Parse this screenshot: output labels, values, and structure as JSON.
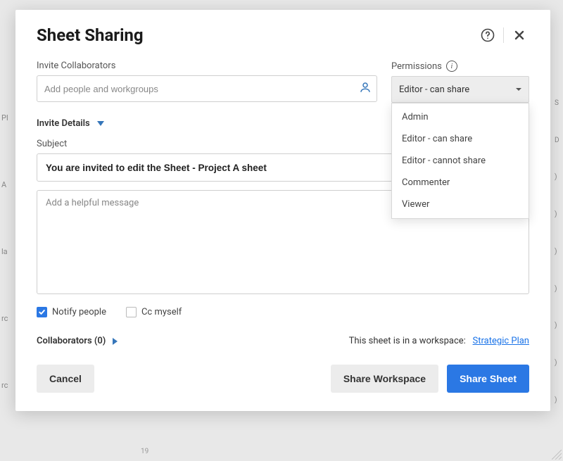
{
  "modal": {
    "title": "Sheet Sharing",
    "invite_label": "Invite Collaborators",
    "invite_placeholder": "Add people and workgroups",
    "permissions_label": "Permissions",
    "permissions_selected": "Editor - can share",
    "permissions_options": [
      "Admin",
      "Editor - can share",
      "Editor - cannot share",
      "Commenter",
      "Viewer"
    ],
    "invite_details_label": "Invite Details",
    "subject_label": "Subject",
    "subject_value": "You are invited to edit the Sheet - Project A sheet",
    "message_placeholder": "Add a helpful message",
    "notify_label": "Notify people",
    "cc_label": "Cc myself",
    "collaborators_label": "Collaborators (0)",
    "workspace_note_prefix": "This sheet is in a workspace:",
    "workspace_link": "Strategic Plan",
    "cancel_label": "Cancel",
    "share_workspace_label": "Share Workspace",
    "share_sheet_label": "Share Sheet"
  }
}
